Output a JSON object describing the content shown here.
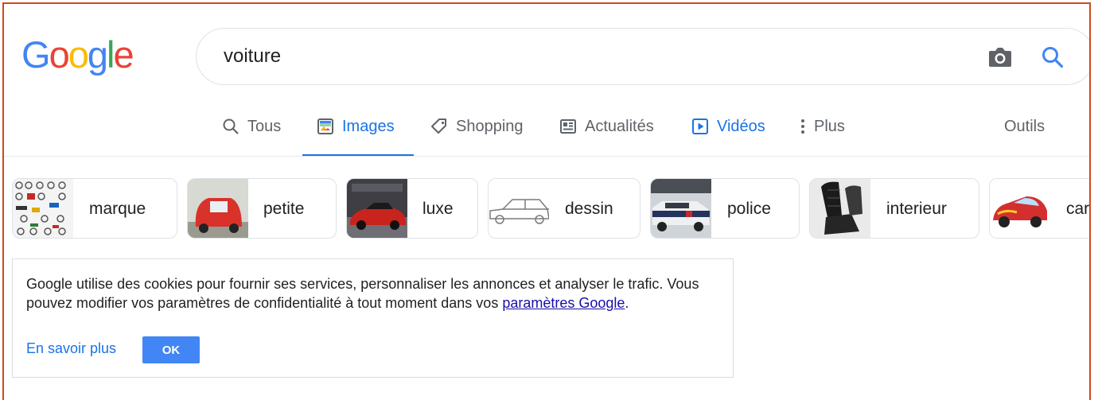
{
  "logo": {
    "letters": [
      "G",
      "o",
      "o",
      "g",
      "l",
      "e"
    ],
    "colors": [
      "#4285f4",
      "#ea4335",
      "#fbbc05",
      "#4285f4",
      "#34a853",
      "#ea4335"
    ]
  },
  "search": {
    "value": "voiture"
  },
  "icons": {
    "camera": "camera-icon",
    "search": "search-icon"
  },
  "tabs": [
    {
      "label": "Tous",
      "icon": "search-icon",
      "state": "normal"
    },
    {
      "label": "Images",
      "icon": "image-icon",
      "state": "active"
    },
    {
      "label": "Shopping",
      "icon": "tag-icon",
      "state": "normal"
    },
    {
      "label": "Actualités",
      "icon": "news-icon",
      "state": "normal"
    },
    {
      "label": "Vidéos",
      "icon": "play-icon",
      "state": "blue"
    },
    {
      "label": "Plus",
      "icon": "more-vert-icon",
      "state": "normal"
    }
  ],
  "tools_label": "Outils",
  "chips": [
    {
      "label": "marque"
    },
    {
      "label": "petite"
    },
    {
      "label": "luxe"
    },
    {
      "label": "dessin"
    },
    {
      "label": "police"
    },
    {
      "label": "interieur"
    },
    {
      "label": "cars"
    }
  ],
  "cookie": {
    "text_before": "Google utilise des cookies pour fournir ses services, personnaliser les annonces et analyser le trafic. Vous pouvez modifier vos paramètres de confidentialité à tout moment dans vos ",
    "link": "paramètres Google",
    "text_after": ".",
    "learn_more": "En savoir plus",
    "ok": "OK"
  },
  "colors": {
    "accent": "#1a73e8",
    "ok_button": "#4285f4",
    "frame": "#cc4a1c"
  }
}
